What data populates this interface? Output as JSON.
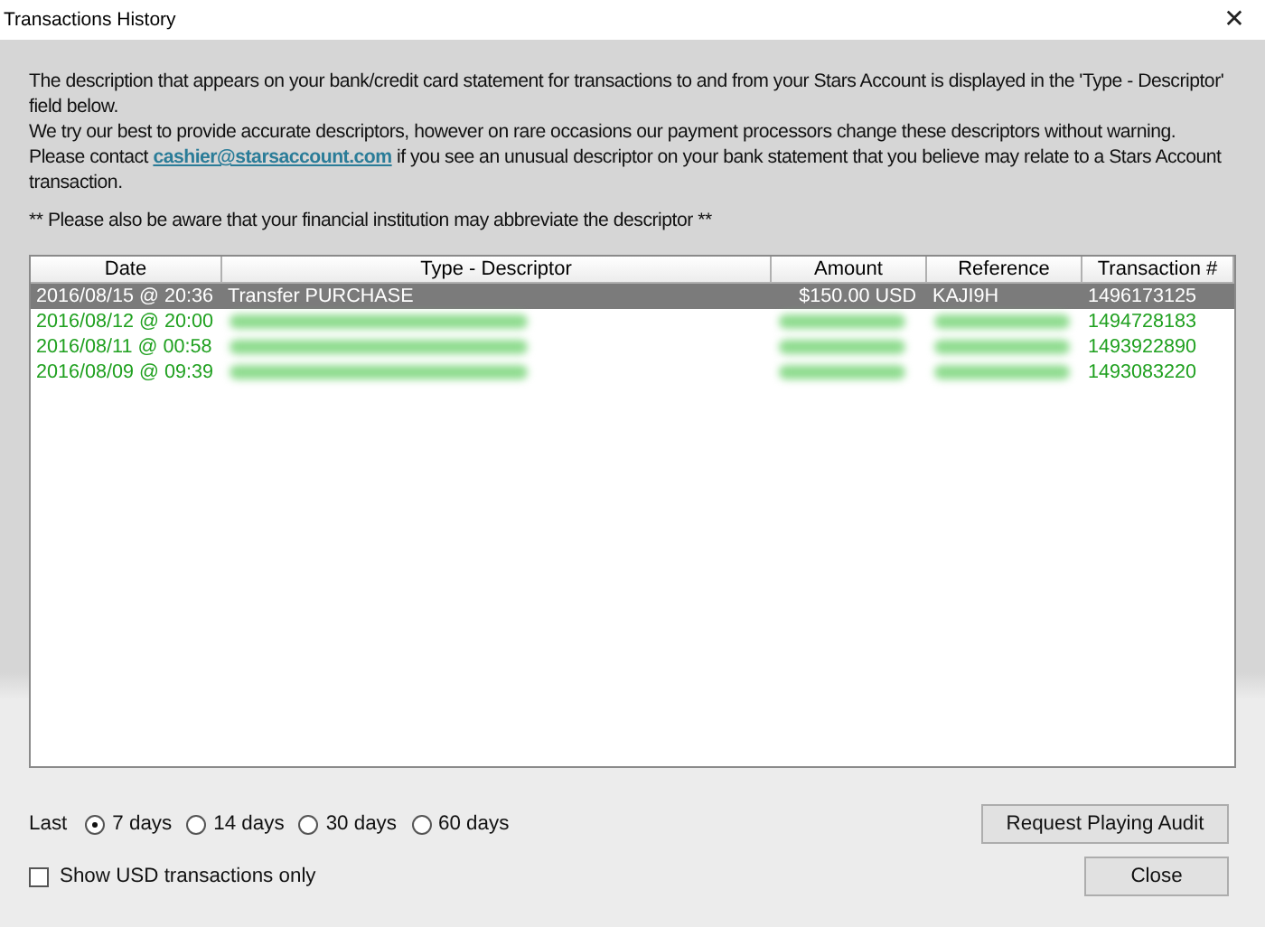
{
  "window": {
    "title": "Transactions History",
    "close": "✕"
  },
  "intro": {
    "line_1": "The description that appears on your bank/credit card statement for transactions to and from your Stars Account is displayed in the 'Type - Descriptor' field below.",
    "line_2": "We try our best to provide accurate descriptors, however on rare occasions our payment processors change these descriptors without warning.",
    "line_3_before": "Please contact",
    "email": "cashier@starsaccount.com",
    "line_3_after": "if you see an unusual descriptor on your bank statement that you believe may relate to a Stars Account transaction.",
    "note": "** Please also be aware that your financial institution may abbreviate the descriptor **"
  },
  "table": {
    "columns": [
      "Date",
      "Type - Descriptor",
      "Amount",
      "Reference",
      "Transaction #"
    ],
    "rows": [
      {
        "date": "2016/08/15 @ 20:36",
        "descriptor": "Transfer PURCHASE",
        "amount": "$150.00 USD",
        "reference": "KAJI9H",
        "transaction": "1496173125",
        "selected": true,
        "obscured": false
      },
      {
        "date": "2016/08/12 @ 20:00",
        "transaction": "1494728183",
        "selected": false,
        "obscured": true
      },
      {
        "date": "2016/08/11 @ 00:58",
        "transaction": "1493922890",
        "selected": false,
        "obscured": true
      },
      {
        "date": "2016/08/09 @ 09:39",
        "transaction": "1493083220",
        "selected": false,
        "obscured": true
      }
    ]
  },
  "period": {
    "label": "Last",
    "options": [
      {
        "label": "7 days",
        "selected": true
      },
      {
        "label": "14 days",
        "selected": false
      },
      {
        "label": "30 days",
        "selected": false
      },
      {
        "label": "60 days",
        "selected": false
      }
    ]
  },
  "usd_only": {
    "label": "Show USD transactions only",
    "checked": false
  },
  "buttons": [
    "Request Playing Audit",
    "Close"
  ]
}
